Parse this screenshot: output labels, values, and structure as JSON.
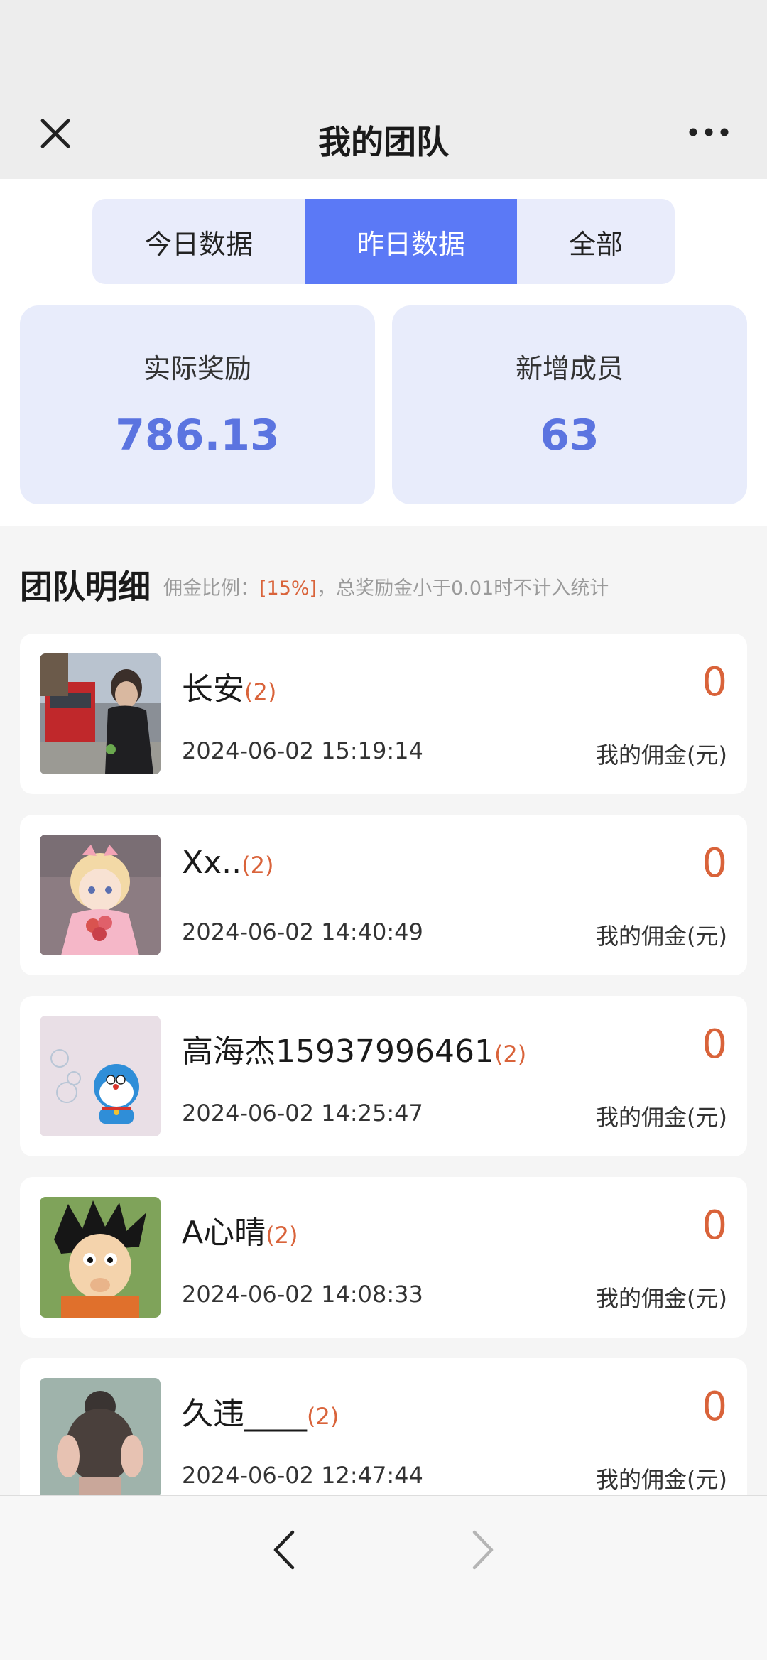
{
  "header": {
    "title": "我的团队"
  },
  "tabs": [
    {
      "label": "今日数据"
    },
    {
      "label": "昨日数据",
      "active": true
    },
    {
      "label": "全部"
    }
  ],
  "stats": {
    "reward_label": "实际奖励",
    "reward_value": "786.13",
    "members_label": "新增成员",
    "members_value": "63"
  },
  "section": {
    "title": "团队明细",
    "note_prefix": "佣金比例：",
    "note_rate": "[15%]",
    "note_suffix": "，总奖励金小于0.01时不计入统计"
  },
  "members": [
    {
      "name": "长安",
      "count": "(2)",
      "time": "2024-06-02 15:19:14",
      "amount": "0",
      "caption": "我的佣金(元)"
    },
    {
      "name": "Xx..",
      "count": "(2)",
      "time": "2024-06-02 14:40:49",
      "amount": "0",
      "caption": "我的佣金(元)"
    },
    {
      "name": "高海杰15937996461",
      "count": "(2)",
      "time": "2024-06-02 14:25:47",
      "amount": "0",
      "caption": "我的佣金(元)"
    },
    {
      "name": "A心晴",
      "count": "(2)",
      "time": "2024-06-02 14:08:33",
      "amount": "0",
      "caption": "我的佣金(元)"
    },
    {
      "name": "久违____",
      "count": "(2)",
      "time": "2024-06-02 12:47:44",
      "amount": "0",
      "caption": "我的佣金(元)"
    }
  ],
  "colors": {
    "accent": "#5b79f6",
    "stat_bg": "#e8ecfb",
    "highlight": "#d9633a"
  },
  "icons": {
    "close": "close-icon",
    "more": "more-icon",
    "back": "chevron-left-icon",
    "forward": "chevron-right-icon"
  }
}
